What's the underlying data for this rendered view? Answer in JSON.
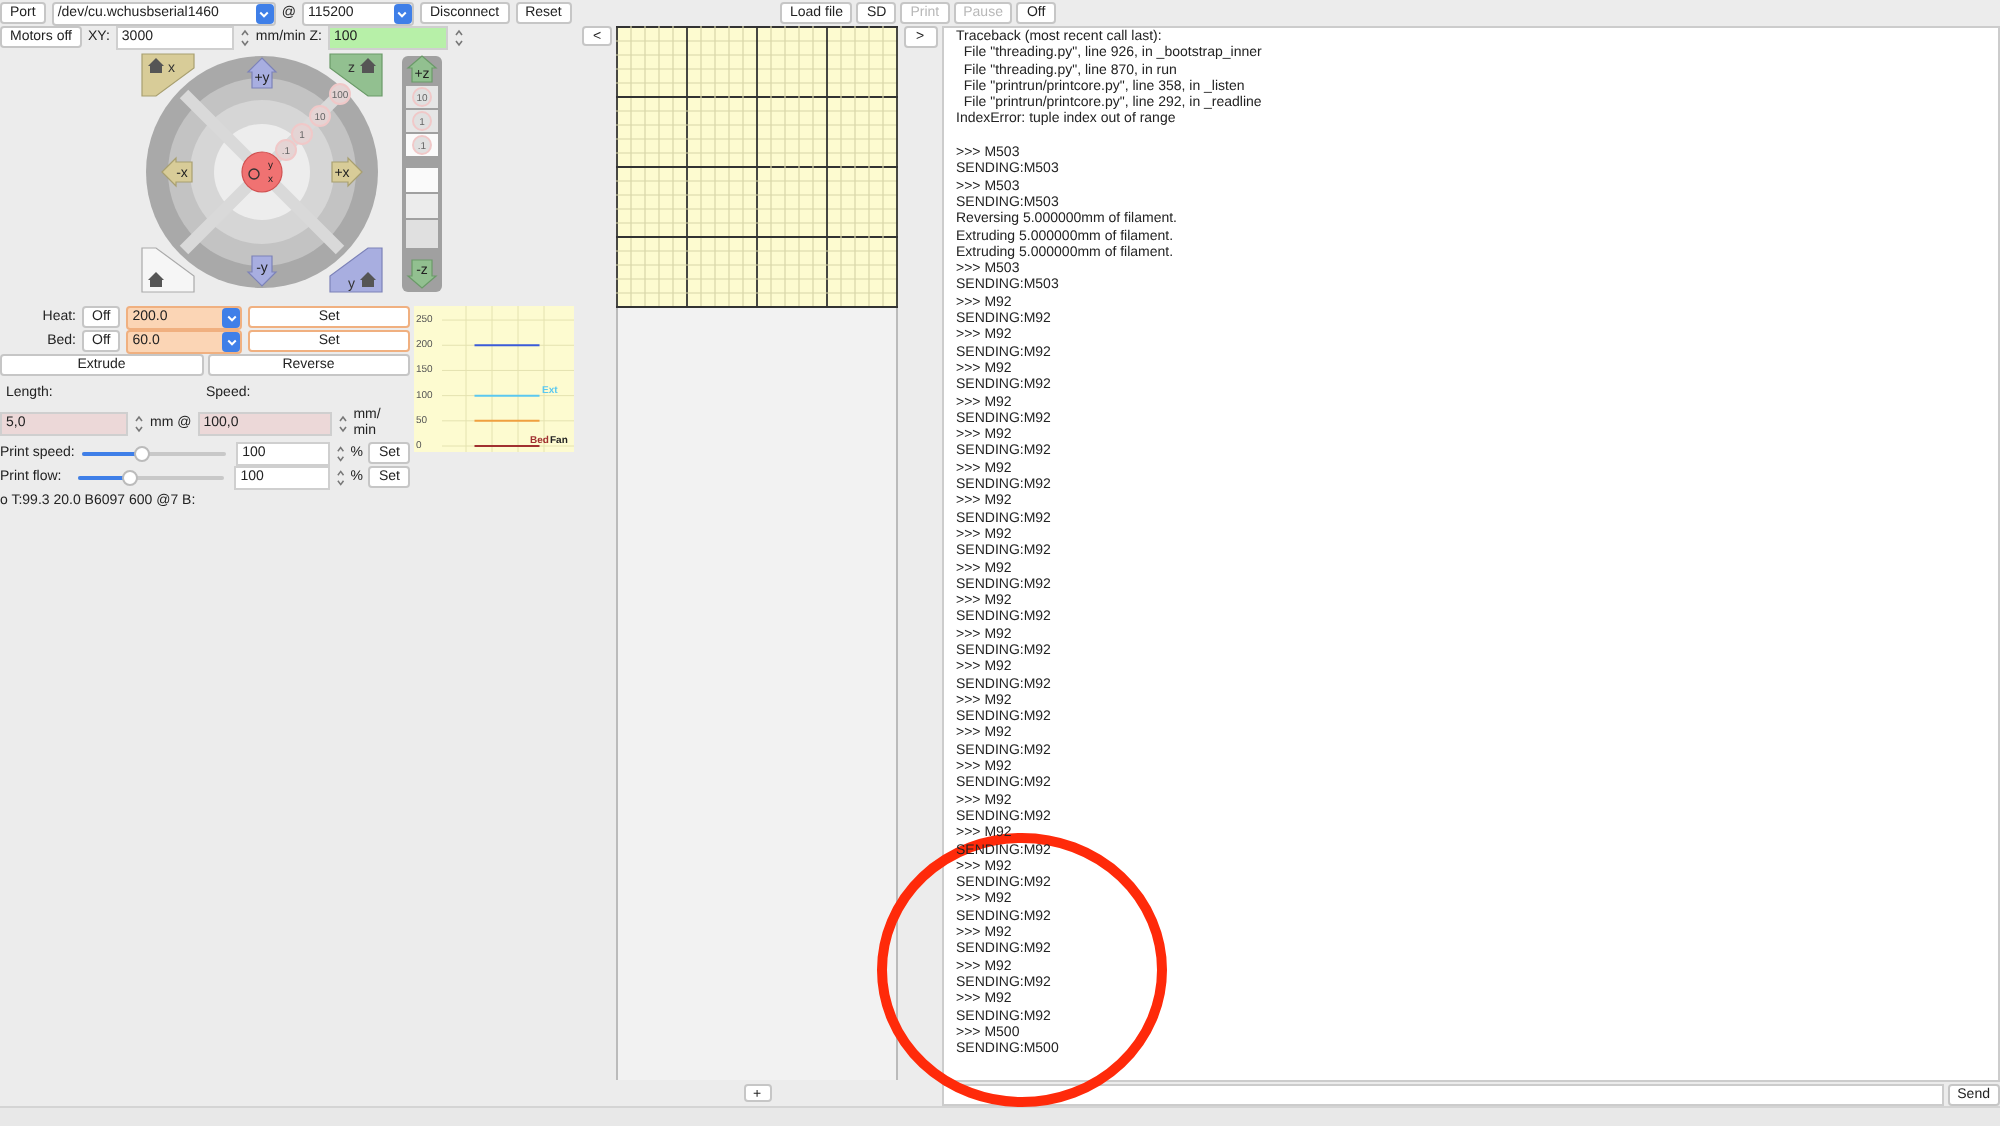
{
  "connection": {
    "port_button": "Port",
    "port": "/dev/cu.wchusbserial1460",
    "at": "@",
    "baud": "115200",
    "disconnect": "Disconnect",
    "reset": "Reset"
  },
  "motion": {
    "motors_off": "Motors off",
    "xy_label": "XY:",
    "xy_feed": "3000",
    "z_label": "mm/min Z:",
    "z_feed": "100"
  },
  "jog": {
    "home_x": "x",
    "home_z": "z",
    "home_y": "y",
    "plus_y": "+y",
    "minus_y": "-y",
    "minus_x": "-x",
    "plus_x": "+x",
    "steps": [
      "100",
      "10",
      "1",
      ".1"
    ],
    "center": [
      "y",
      "x"
    ],
    "plus_z": "+z",
    "minus_z": "-z",
    "z_steps": [
      "10",
      "1",
      ".1"
    ]
  },
  "temperature": [
    {
      "label": "Heat:",
      "off": "Off",
      "value": "200.0",
      "set": "Set"
    },
    {
      "label": "Bed:",
      "off": "Off",
      "value": "60.0",
      "set": "Set"
    }
  ],
  "extrusion": {
    "extrude": "Extrude",
    "reverse": "Reverse",
    "length_label": "Length:",
    "length": "5,0",
    "mm_at": "mm @",
    "speed_label": "Speed:",
    "speed": "100,0",
    "unit": "mm/ min"
  },
  "sliders": [
    {
      "label": "Print speed:",
      "level": 0.42,
      "value": "100",
      "unit": "%",
      "set": "Set"
    },
    {
      "label": "Print flow:",
      "level": 0.36,
      "value": "100",
      "unit": "%",
      "set": "Set"
    }
  ],
  "status_line": "o T:99.3 20.0 B6097 600 @7 B:",
  "temp_graph": {
    "fan_label": "Fan",
    "chart_data": {
      "type": "line",
      "grid": true,
      "ylim": [
        0,
        270
      ],
      "yticks": [
        0,
        50,
        100,
        150,
        200,
        250
      ],
      "series": [
        {
          "color": "#3b5bd9",
          "values": [
            200,
            200
          ]
        },
        {
          "name": "Ext",
          "color": "#5bc8f0",
          "values": [
            100,
            100
          ]
        },
        {
          "color": "#f0a040",
          "values": [
            50,
            50
          ]
        },
        {
          "name": "Bed",
          "color": "#a03030",
          "values": [
            0,
            0
          ]
        }
      ]
    }
  },
  "toolbar": [
    {
      "label": "Load file",
      "disabled": false
    },
    {
      "label": "SD",
      "disabled": false
    },
    {
      "label": "Print",
      "disabled": true
    },
    {
      "label": "Pause",
      "disabled": true
    },
    {
      "label": "Off",
      "disabled": false
    }
  ],
  "left_toggle": "<",
  "right_toggle": ">",
  "add_button": "+",
  "console": {
    "traceback": [
      "Traceback (most recent call last):",
      "  File \"threading.py\", line 926, in _bootstrap_inner",
      "  File \"threading.py\", line 870, in run",
      "  File \"printrun/printcore.py\", line 358, in _listen",
      "  File \"printrun/printcore.py\", line 292, in _readline",
      "IndexError: tuple index out of range"
    ],
    "log": [
      ">>> M503",
      "SENDING:M503",
      ">>> M503",
      "SENDING:M503",
      "Reversing 5.000000mm of filament.",
      "Extruding 5.000000mm of filament.",
      "Extruding 5.000000mm of filament.",
      ">>> M503",
      "SENDING:M503",
      ">>> M92",
      "SENDING:M92",
      ">>> M92",
      "SENDING:M92",
      ">>> M92",
      "SENDING:M92",
      ">>> M92",
      "SENDING:M92",
      ">>> M92",
      "SENDING:M92",
      ">>> M92",
      "SENDING:M92",
      ">>> M92",
      "SENDING:M92",
      ">>> M92",
      "SENDING:M92",
      ">>> M92",
      "SENDING:M92",
      ">>> M92",
      "SENDING:M92",
      ">>> M92",
      "SENDING:M92",
      ">>> M92",
      "SENDING:M92",
      ">>> M92",
      "SENDING:M92",
      ">>> M92",
      "SENDING:M92",
      ">>> M92",
      "SENDING:M92",
      ">>> M92",
      "SENDING:M92",
      ">>> M92",
      "SENDING:M92",
      ">>> M92",
      "SENDING:M92",
      ">>> M92",
      "SENDING:M92",
      ">>> M92",
      "SENDING:M92",
      ">>> M92",
      "SENDING:M92",
      ">>> M92",
      "SENDING:M92",
      ">>> M500",
      "SENDING:M500"
    ],
    "send": "Send"
  }
}
